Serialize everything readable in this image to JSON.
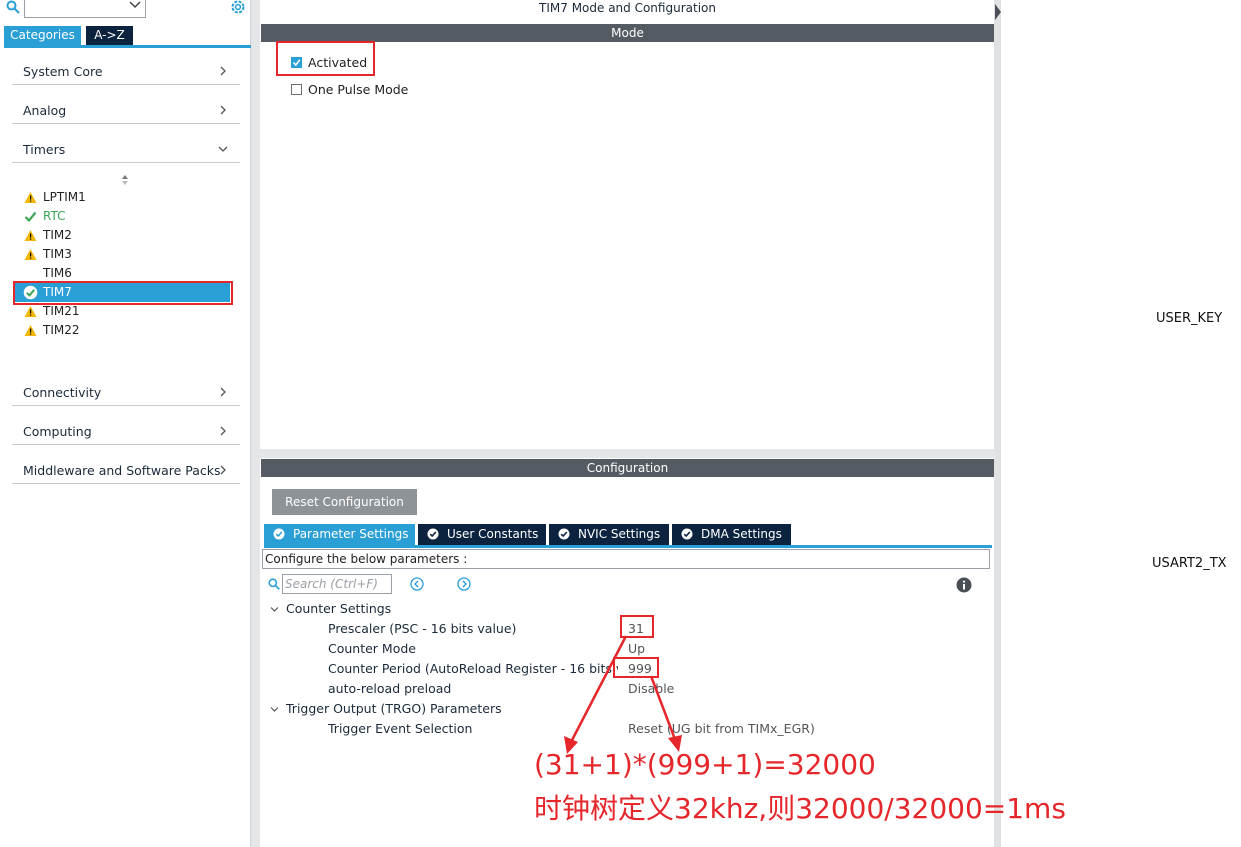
{
  "left_panel": {
    "tabs": {
      "categories": "Categories",
      "az": "A->Z"
    },
    "categories": [
      {
        "label": "System Core"
      },
      {
        "label": "Analog"
      },
      {
        "label": "Timers"
      }
    ],
    "timer_items": [
      {
        "label": "LPTIM1",
        "status": "warning"
      },
      {
        "label": "RTC",
        "status": "ok"
      },
      {
        "label": "TIM2",
        "status": "warning"
      },
      {
        "label": "TIM3",
        "status": "warning"
      },
      {
        "label": "TIM6",
        "status": "none"
      },
      {
        "label": "TIM7",
        "status": "ok-selected"
      },
      {
        "label": "TIM21",
        "status": "warning"
      },
      {
        "label": "TIM22",
        "status": "warning"
      }
    ],
    "more_categories": [
      {
        "label": "Connectivity"
      },
      {
        "label": "Computing"
      },
      {
        "label": "Middleware and Software Packs"
      }
    ]
  },
  "center_panel": {
    "title": "TIM7 Mode and Configuration",
    "mode_header": "Mode",
    "mode_options": {
      "activated": {
        "label": "Activated",
        "checked": true
      },
      "one_pulse": {
        "label": "One Pulse Mode",
        "checked": false
      }
    },
    "config_header": "Configuration",
    "reset_button": "Reset Configuration",
    "tabs": [
      {
        "label": "Parameter Settings"
      },
      {
        "label": "User Constants"
      },
      {
        "label": "NVIC Settings"
      },
      {
        "label": "DMA Settings"
      }
    ],
    "configure_text": "Configure the below parameters :",
    "search_placeholder": "Search (Ctrl+F)",
    "groups": [
      {
        "name": "Counter Settings",
        "params": [
          {
            "name": "Prescaler (PSC - 16 bits value)",
            "value": "31"
          },
          {
            "name": "Counter Mode",
            "value": "Up"
          },
          {
            "name": "Counter Period (AutoReload Register - 16 bits val...",
            "value": "999"
          },
          {
            "name": "auto-reload preload",
            "value": "Disable"
          }
        ]
      },
      {
        "name": "Trigger Output (TRGO) Parameters",
        "params": [
          {
            "name": "Trigger Event Selection",
            "value": "Reset (UG bit from TIMx_EGR)"
          }
        ]
      }
    ]
  },
  "annotation": {
    "line1": "(31+1)*(999+1)=32000",
    "line2": "时钟树定义32khz,则32000/32000=1ms",
    "color": "#e5262b"
  },
  "right_panel": {
    "labels": [
      "USER_KEY",
      "USART2_TX"
    ]
  },
  "colors": {
    "accent": "#2a9fd6",
    "navy": "#0c2340",
    "header_bar": "#555b62",
    "warning": "#f2b705",
    "ok": "#3aa655",
    "annotation_red": "#e5262b"
  }
}
